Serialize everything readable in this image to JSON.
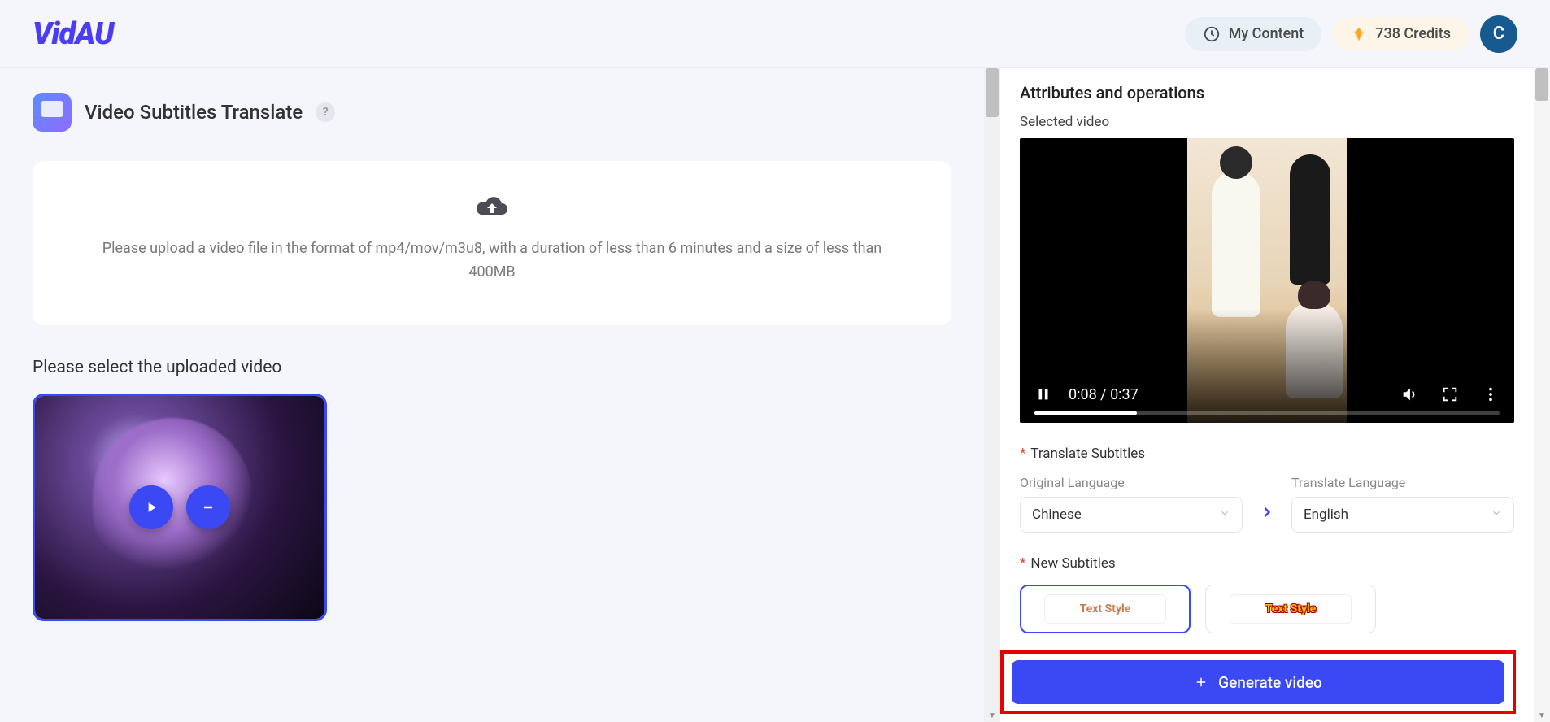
{
  "header": {
    "logo": "VidAU",
    "my_content_label": "My Content",
    "credits_label": "738 Credits",
    "avatar_initial": "C"
  },
  "left": {
    "feature_title": "Video Subtitles Translate",
    "help_glyph": "?",
    "upload_hint": "Please upload a video file in the format of mp4/mov/m3u8, with a duration of less than 6 minutes and a size of less than 400MB",
    "select_label": "Please select the uploaded video"
  },
  "right": {
    "section_title": "Attributes and operations",
    "selected_video_label": "Selected video",
    "player": {
      "time_display": "0:08 / 0:37",
      "progress_pct": 22
    },
    "translate_subtitles_label": "Translate Subtitles",
    "original_language_label": "Original Language",
    "translate_language_label": "Translate Language",
    "original_language_value": "Chinese",
    "translate_language_value": "English",
    "new_subtitles_label": "New Subtitles",
    "style_sample_text": "Text Style",
    "generate_label": "Generate video"
  }
}
